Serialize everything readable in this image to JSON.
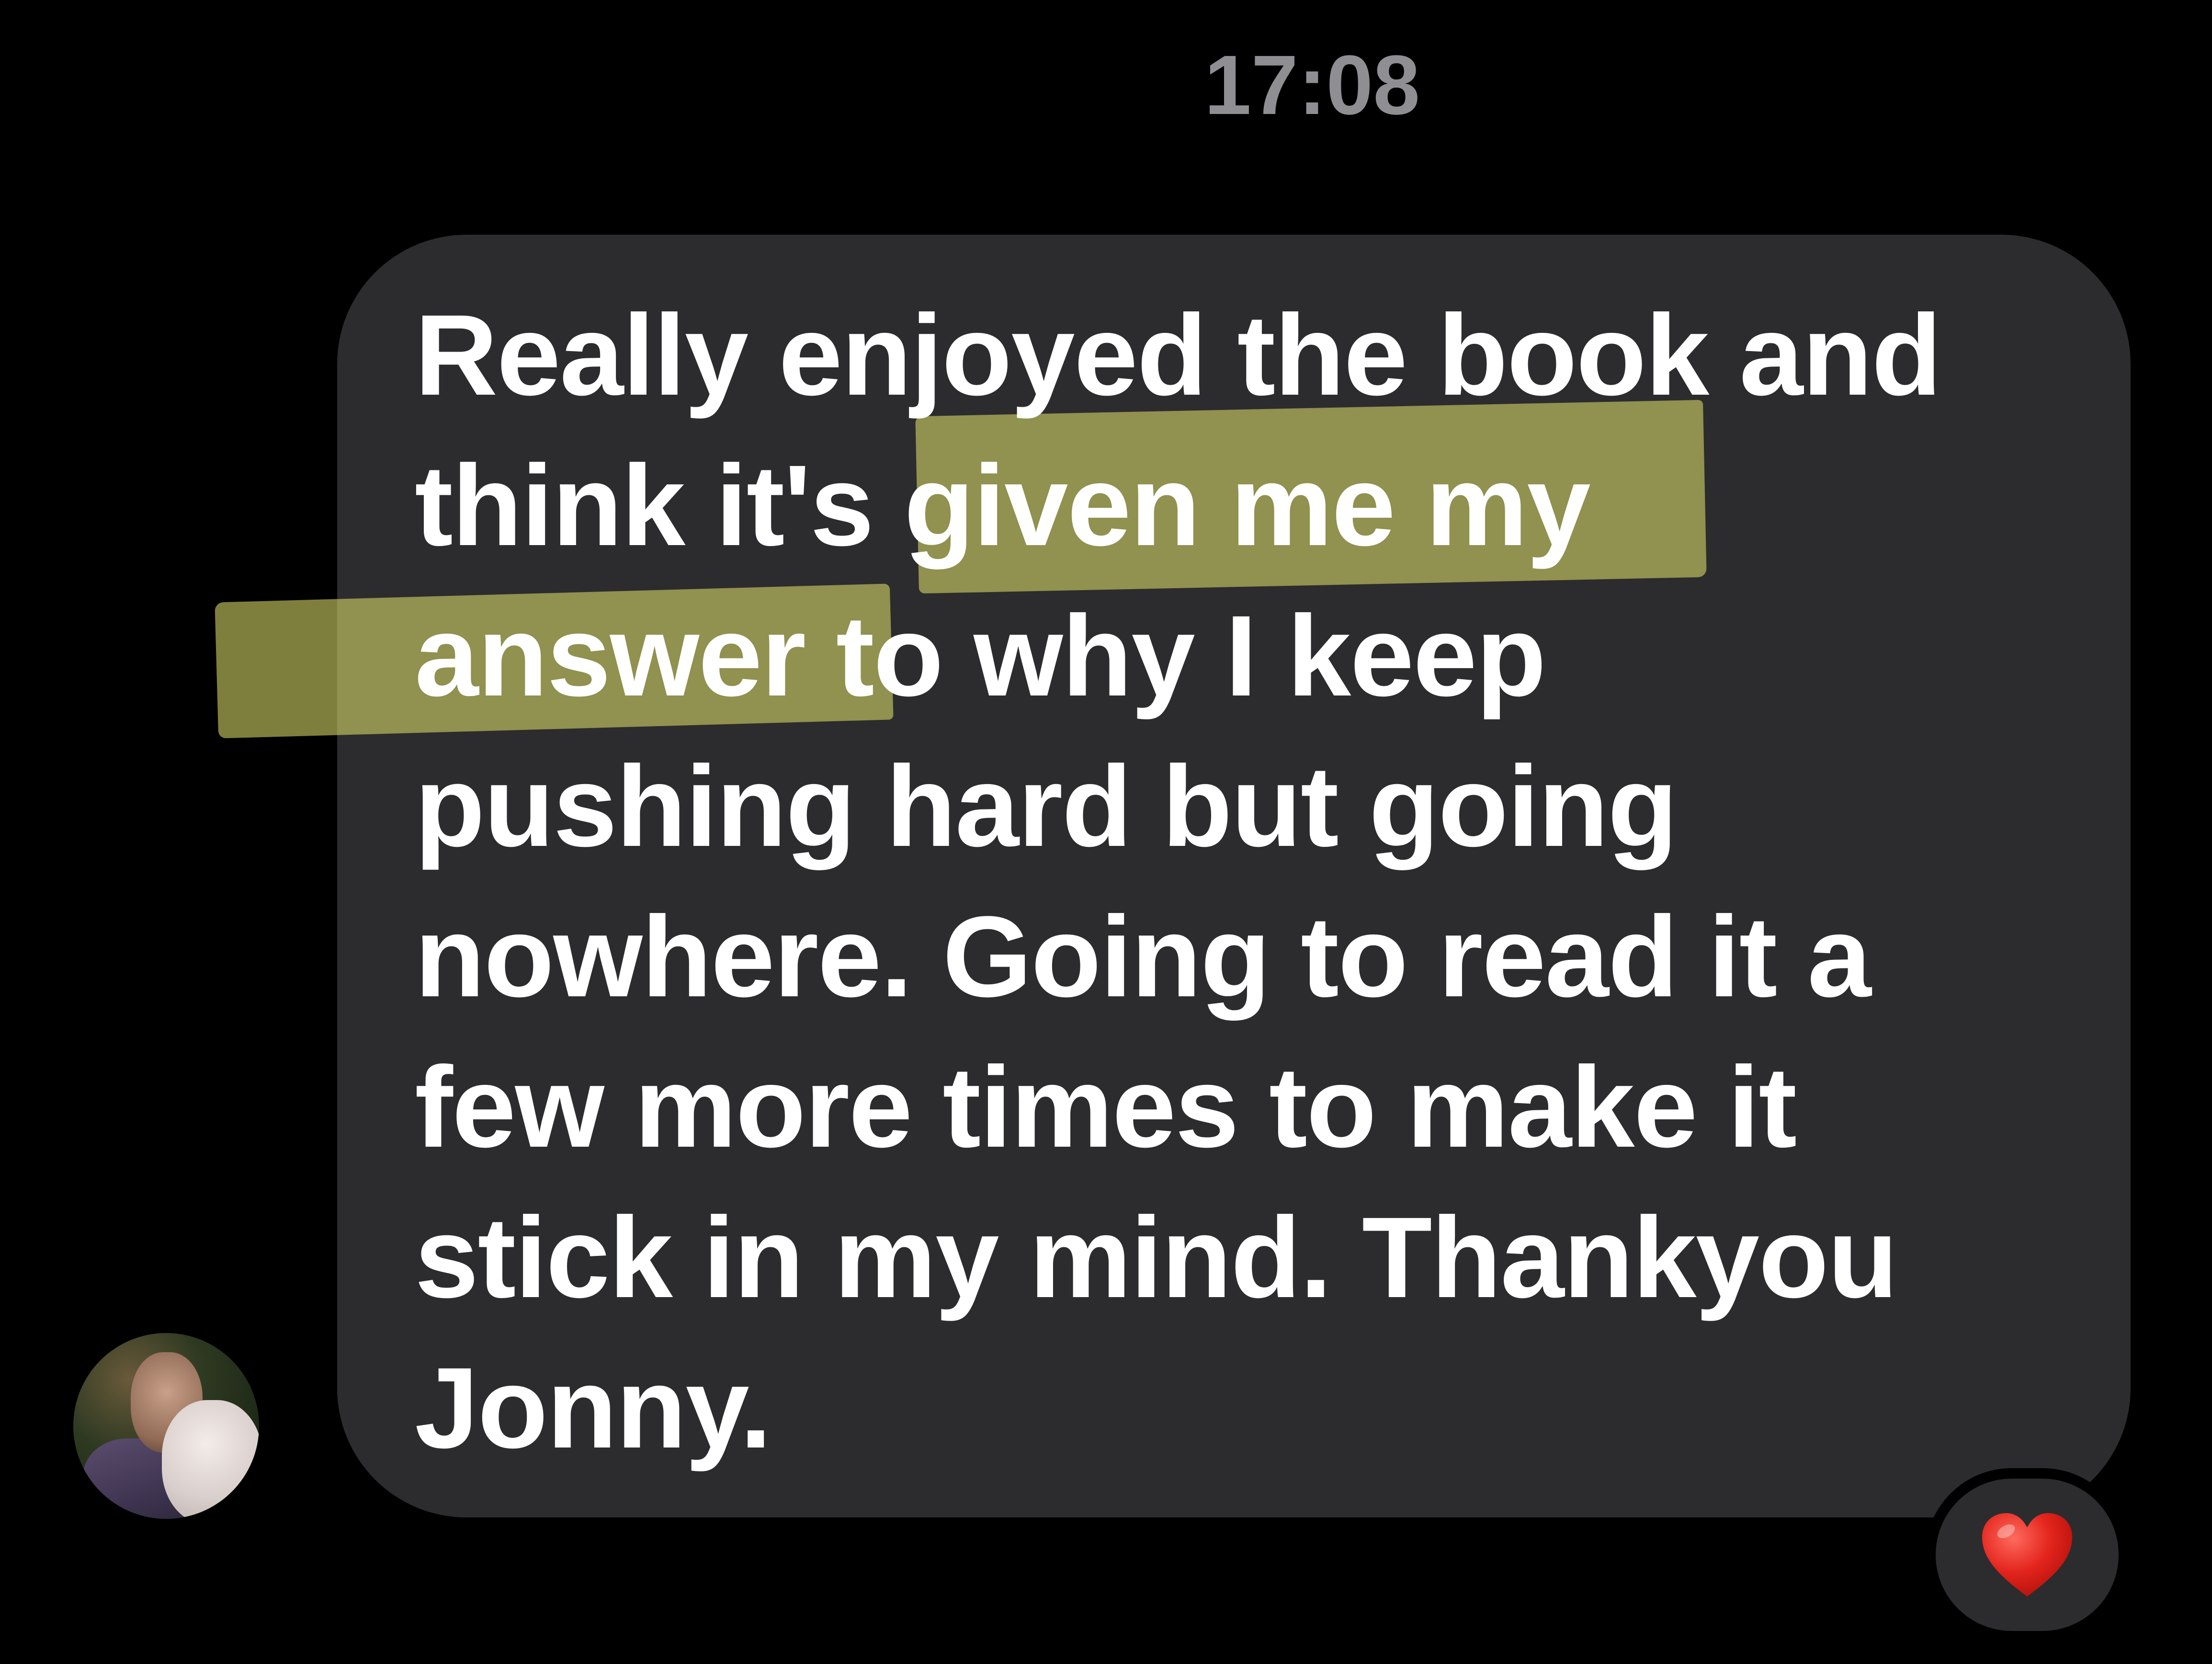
{
  "timestamp": "17:08",
  "message": {
    "text": "Really enjoyed the book and\nthink it's given me my\nanswer to why I keep\npushing hard but going\nnowhere. Going to read it a\nfew more times to make it\nstick in my mind. Thankyou\nJonny.",
    "highlighted_text": "given me my answer t",
    "highlight_color": "#dada69",
    "bubble_color": "#2c2c2e"
  },
  "reaction": {
    "icon": "red-heart-icon",
    "color": "#e3241c"
  },
  "avatar": {
    "icon": "contact-photo"
  }
}
